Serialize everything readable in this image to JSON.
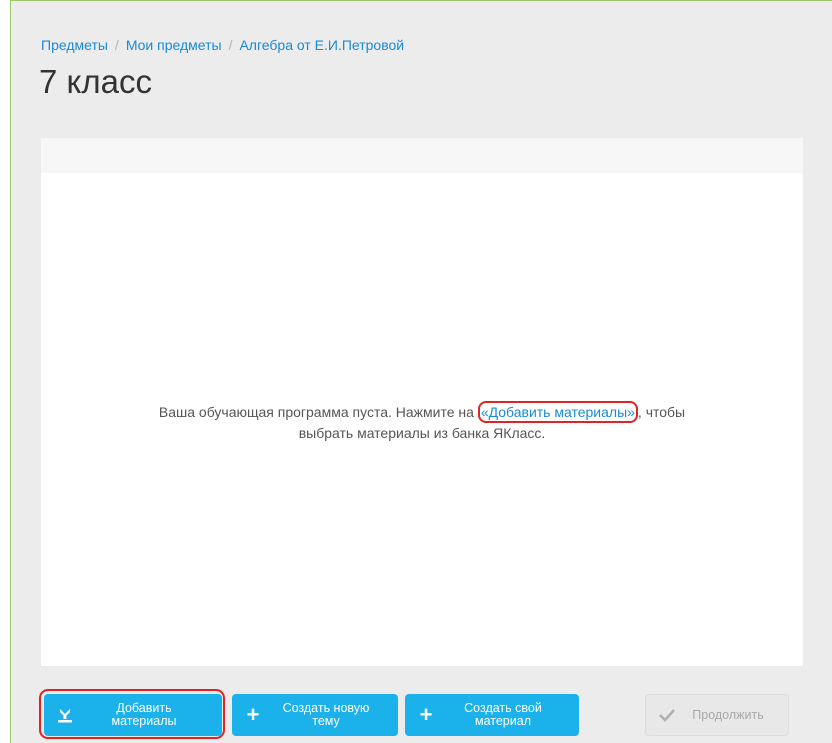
{
  "breadcrumb": {
    "items": [
      "Предметы",
      "Мои предметы",
      "Алгебра от Е.И.Петровой"
    ],
    "separator": "/"
  },
  "page_title": "7 класс",
  "empty_state": {
    "before": "Ваша обучающая программа пуста. Нажмите на ",
    "link": "«Добавить материалы»",
    "after": ", чтобы",
    "line2": "выбрать материалы из банка ЯКласс."
  },
  "actions": {
    "add_materials_line1": "Добавить",
    "add_materials_line2": "материалы",
    "new_topic_line1": "Создать новую",
    "new_topic_line2": "тему",
    "own_material_line1": "Создать свой",
    "own_material_line2": "материал",
    "continue": "Продолжить"
  },
  "icons": {
    "add_materials": "download-tray-icon",
    "new_topic": "plus-icon",
    "own_material": "plus-icon",
    "continue": "checkmark-icon"
  },
  "colors": {
    "link": "#1a8ad4",
    "button": "#1bb1ea",
    "highlight": "#e32323",
    "disabled": "#e8e8e8"
  }
}
